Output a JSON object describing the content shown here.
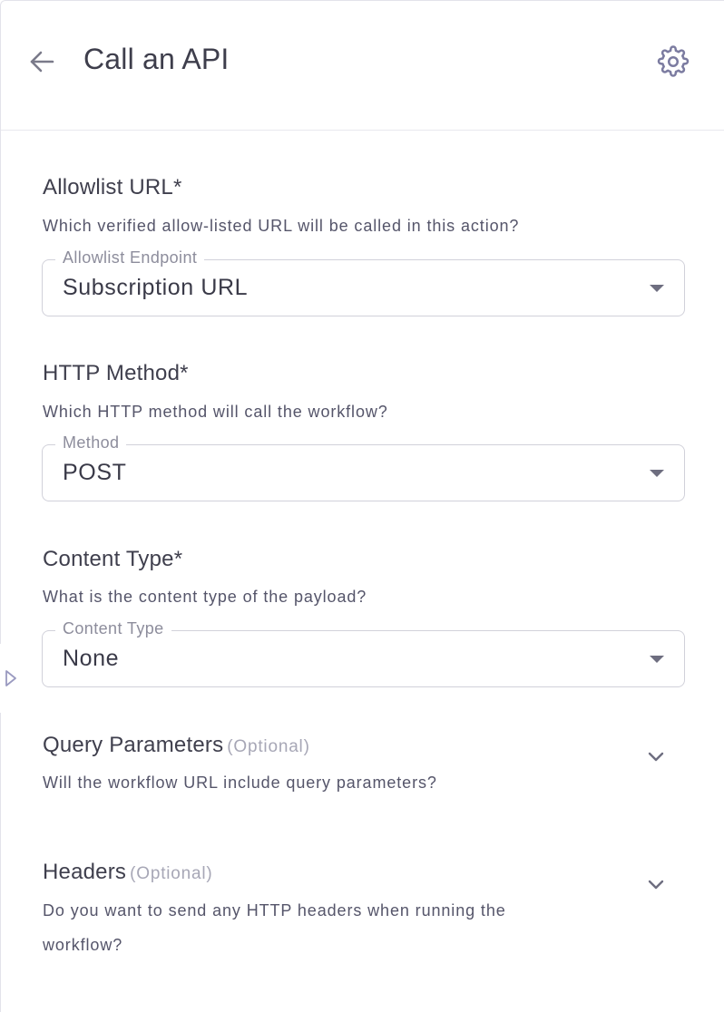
{
  "header": {
    "title": "Call an API",
    "back_icon": "arrow-left-icon",
    "settings_icon": "gear-icon"
  },
  "sections": {
    "allowlist": {
      "title": "Allowlist URL*",
      "description": "Which verified allow-listed URL will be called in this action?",
      "field_label": "Allowlist Endpoint",
      "field_value": "Subscription URL"
    },
    "http_method": {
      "title": "HTTP Method*",
      "description": "Which HTTP method will call the workflow?",
      "field_label": "Method",
      "field_value": "POST"
    },
    "content_type": {
      "title": "Content Type*",
      "description": "What is the content type of the payload?",
      "field_label": "Content Type",
      "field_value": "None"
    },
    "query_params": {
      "title": "Query Parameters",
      "optional": "(Optional)",
      "description": "Will the workflow URL include query parameters?"
    },
    "headers": {
      "title": "Headers",
      "optional": "(Optional)",
      "description_line1": "Do you want to send any HTTP headers when running the",
      "description_line2": "workflow?"
    }
  },
  "colors": {
    "text_primary": "#3e3e4c",
    "text_muted": "#a7a7b6",
    "border": "#d1d1da",
    "icon_accent": "#7b7ba0"
  }
}
